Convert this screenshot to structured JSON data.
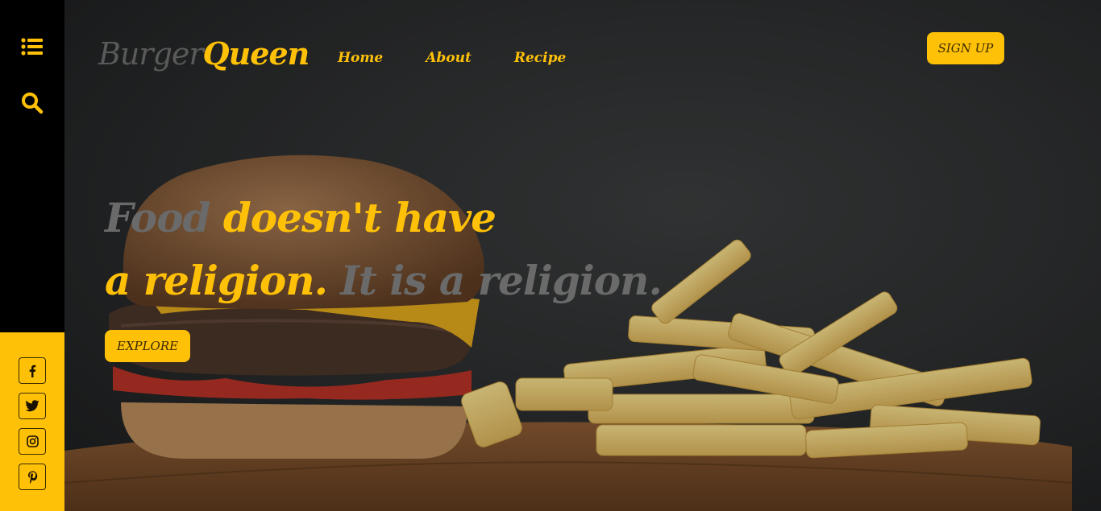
{
  "brand": {
    "part1": "Burger",
    "part2": "Queen"
  },
  "nav": {
    "home": "Home",
    "about": "About",
    "recipe": "Recipe"
  },
  "header": {
    "signup_label": "SIGN UP"
  },
  "hero": {
    "line1_grey": "Food",
    "line1_yellow": " doesn't have",
    "line2_yellow": "a religion.",
    "line2_grey": " It is a religion.",
    "explore_label": "EXPLORE"
  },
  "sidebar": {
    "icons": [
      "list-icon",
      "search-icon"
    ],
    "social": [
      "facebook-icon",
      "twitter-icon",
      "instagram-icon",
      "pinterest-icon"
    ]
  },
  "colors": {
    "accent": "#ffc107",
    "dark": "#000000",
    "text_muted": "#6a6a6a"
  }
}
